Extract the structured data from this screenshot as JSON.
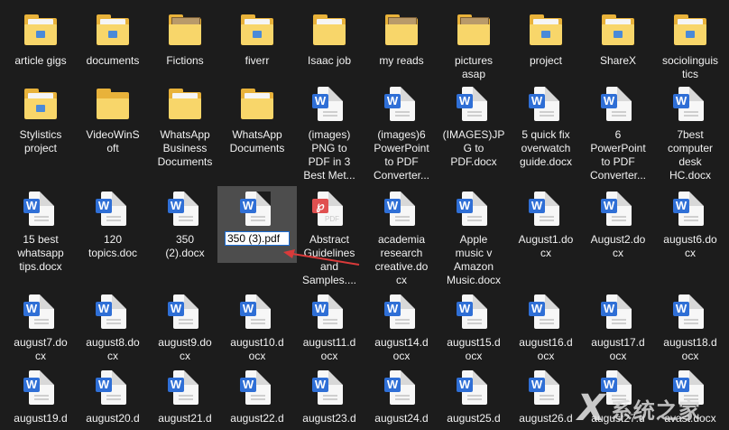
{
  "items": [
    {
      "label": "article gigs",
      "type": "folder",
      "variant": "badge"
    },
    {
      "label": "documents",
      "type": "folder",
      "variant": "badge"
    },
    {
      "label": "Fictions",
      "type": "folder",
      "variant": "thumb"
    },
    {
      "label": "fiverr",
      "type": "folder",
      "variant": "badge"
    },
    {
      "label": "Isaac job",
      "type": "folder",
      "variant": "paper"
    },
    {
      "label": "my reads",
      "type": "folder",
      "variant": "thumb"
    },
    {
      "label": "pictures\nasap",
      "type": "folder",
      "variant": "thumb"
    },
    {
      "label": "project",
      "type": "folder",
      "variant": "badge"
    },
    {
      "label": "ShareX",
      "type": "folder",
      "variant": "badge"
    },
    {
      "label": "sociolinguis\ntics",
      "type": "folder",
      "variant": "badge"
    },
    {
      "label": "Stylistics\nproject",
      "type": "folder",
      "variant": "badge"
    },
    {
      "label": "VideoWinS\noft",
      "type": "folder",
      "variant": "plain"
    },
    {
      "label": "WhatsApp\nBusiness\nDocuments",
      "type": "folder",
      "variant": "paper"
    },
    {
      "label": "WhatsApp\nDocuments",
      "type": "folder",
      "variant": "paper"
    },
    {
      "label": "(images)\nPNG to\nPDF in 3\nBest Met...",
      "type": "docx"
    },
    {
      "label": "(images)6\nPowerPoint\nto PDF\nConverter...",
      "type": "docx"
    },
    {
      "label": "(IMAGES)JP\nG to\nPDF.docx",
      "type": "docx"
    },
    {
      "label": "5 quick fix\noverwatch\nguide.docx",
      "type": "docx"
    },
    {
      "label": "6\nPowerPoint\nto PDF\nConverter...",
      "type": "docx"
    },
    {
      "label": "7best\ncomputer\ndesk\nHC.docx",
      "type": "docx"
    },
    {
      "label": "15 best\nwhatsapp\ntips.docx",
      "type": "docx"
    },
    {
      "label": "120\ntopics.doc",
      "type": "docx"
    },
    {
      "label": "350\n(2).docx",
      "type": "docx"
    },
    {
      "label": "350 (3).pdf",
      "type": "docx",
      "selected": true,
      "renaming": true
    },
    {
      "label": "Abstract\nGuidelines\nand\nSamples....",
      "type": "pdf"
    },
    {
      "label": "academia\nresearch\ncreative.do\ncx",
      "type": "docx"
    },
    {
      "label": "Apple\nmusic v\nAmazon\nMusic.docx",
      "type": "docx"
    },
    {
      "label": "August1.do\ncx",
      "type": "docx"
    },
    {
      "label": "August2.do\ncx",
      "type": "docx"
    },
    {
      "label": "august6.do\ncx",
      "type": "docx"
    },
    {
      "label": "august7.do\ncx",
      "type": "docx"
    },
    {
      "label": "august8.do\ncx",
      "type": "docx"
    },
    {
      "label": "august9.do\ncx",
      "type": "docx"
    },
    {
      "label": "august10.d\nocx",
      "type": "docx"
    },
    {
      "label": "august11.d\nocx",
      "type": "docx"
    },
    {
      "label": "august14.d\nocx",
      "type": "docx"
    },
    {
      "label": "august15.d\nocx",
      "type": "docx"
    },
    {
      "label": "august16.d\nocx",
      "type": "docx"
    },
    {
      "label": "august17.d\nocx",
      "type": "docx"
    },
    {
      "label": "august18.d\nocx",
      "type": "docx"
    },
    {
      "label": "august19.d",
      "type": "docx"
    },
    {
      "label": "august20.d",
      "type": "docx"
    },
    {
      "label": "august21.d",
      "type": "docx"
    },
    {
      "label": "august22.d",
      "type": "docx"
    },
    {
      "label": "august23.d",
      "type": "docx"
    },
    {
      "label": "august24.d",
      "type": "docx"
    },
    {
      "label": "august25.d",
      "type": "docx"
    },
    {
      "label": "august26.d",
      "type": "docx"
    },
    {
      "label": "august27.d",
      "type": "docx"
    },
    {
      "label": "avast.docx",
      "type": "docx"
    }
  ],
  "pdf_icon_text": "PDF",
  "docx_glyph": "W",
  "pdf_glyph": "℘",
  "colors": {
    "background": "#1c1c1c",
    "selection": "#777777",
    "arrow": "#d93a3a",
    "accent": "#1c6ed6"
  },
  "watermark": {
    "text": "系统之家"
  }
}
